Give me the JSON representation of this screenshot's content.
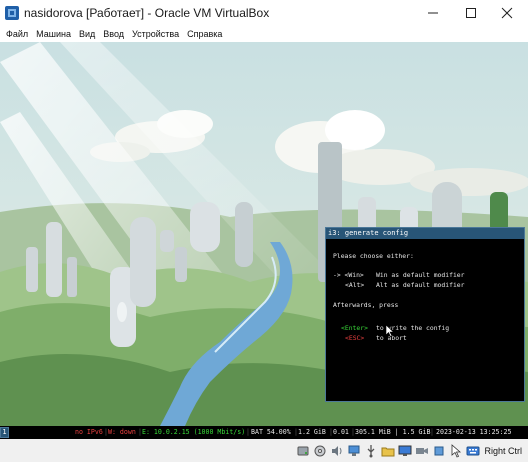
{
  "window": {
    "title": "nasidorova [Работает] - Oracle VM VirtualBox",
    "icon": "virtualbox-icon"
  },
  "menubar": {
    "items": [
      "Файл",
      "Машина",
      "Вид",
      "Ввод",
      "Устройства",
      "Справка"
    ]
  },
  "i3_dialog": {
    "title": "i3: generate config",
    "prompt": "Please choose either:",
    "opt1_arrow": "-> ",
    "opt1_key": "<Win>",
    "opt1_desc": "Win as default modifier",
    "opt2_key": "<Alt>",
    "opt2_desc": "Alt as default modifier",
    "afterwards": "Afterwards, press",
    "enter_key": "<Enter>",
    "enter_desc": "to write the config",
    "esc_key": "<ESC>",
    "esc_desc": "to abort"
  },
  "i3bar": {
    "workspace": "1",
    "ipv6": "no IPv6",
    "wifi": "W: down",
    "ethernet": "E: 10.0.2.15 (1000 Mbit/s)",
    "battery": "BAT 54.00%",
    "disk": "1.2 GiB",
    "load": "0.01",
    "memory": "305.1 MiB | 1.5 GiB",
    "datetime": "2023-02-13 13:25:25"
  },
  "host_status": {
    "host_key": "Right Ctrl"
  },
  "colors": {
    "i3_focused_title": "#285577",
    "i3_border": "#4c7899",
    "ok_green": "#38d638",
    "bad_red": "#e84040"
  }
}
